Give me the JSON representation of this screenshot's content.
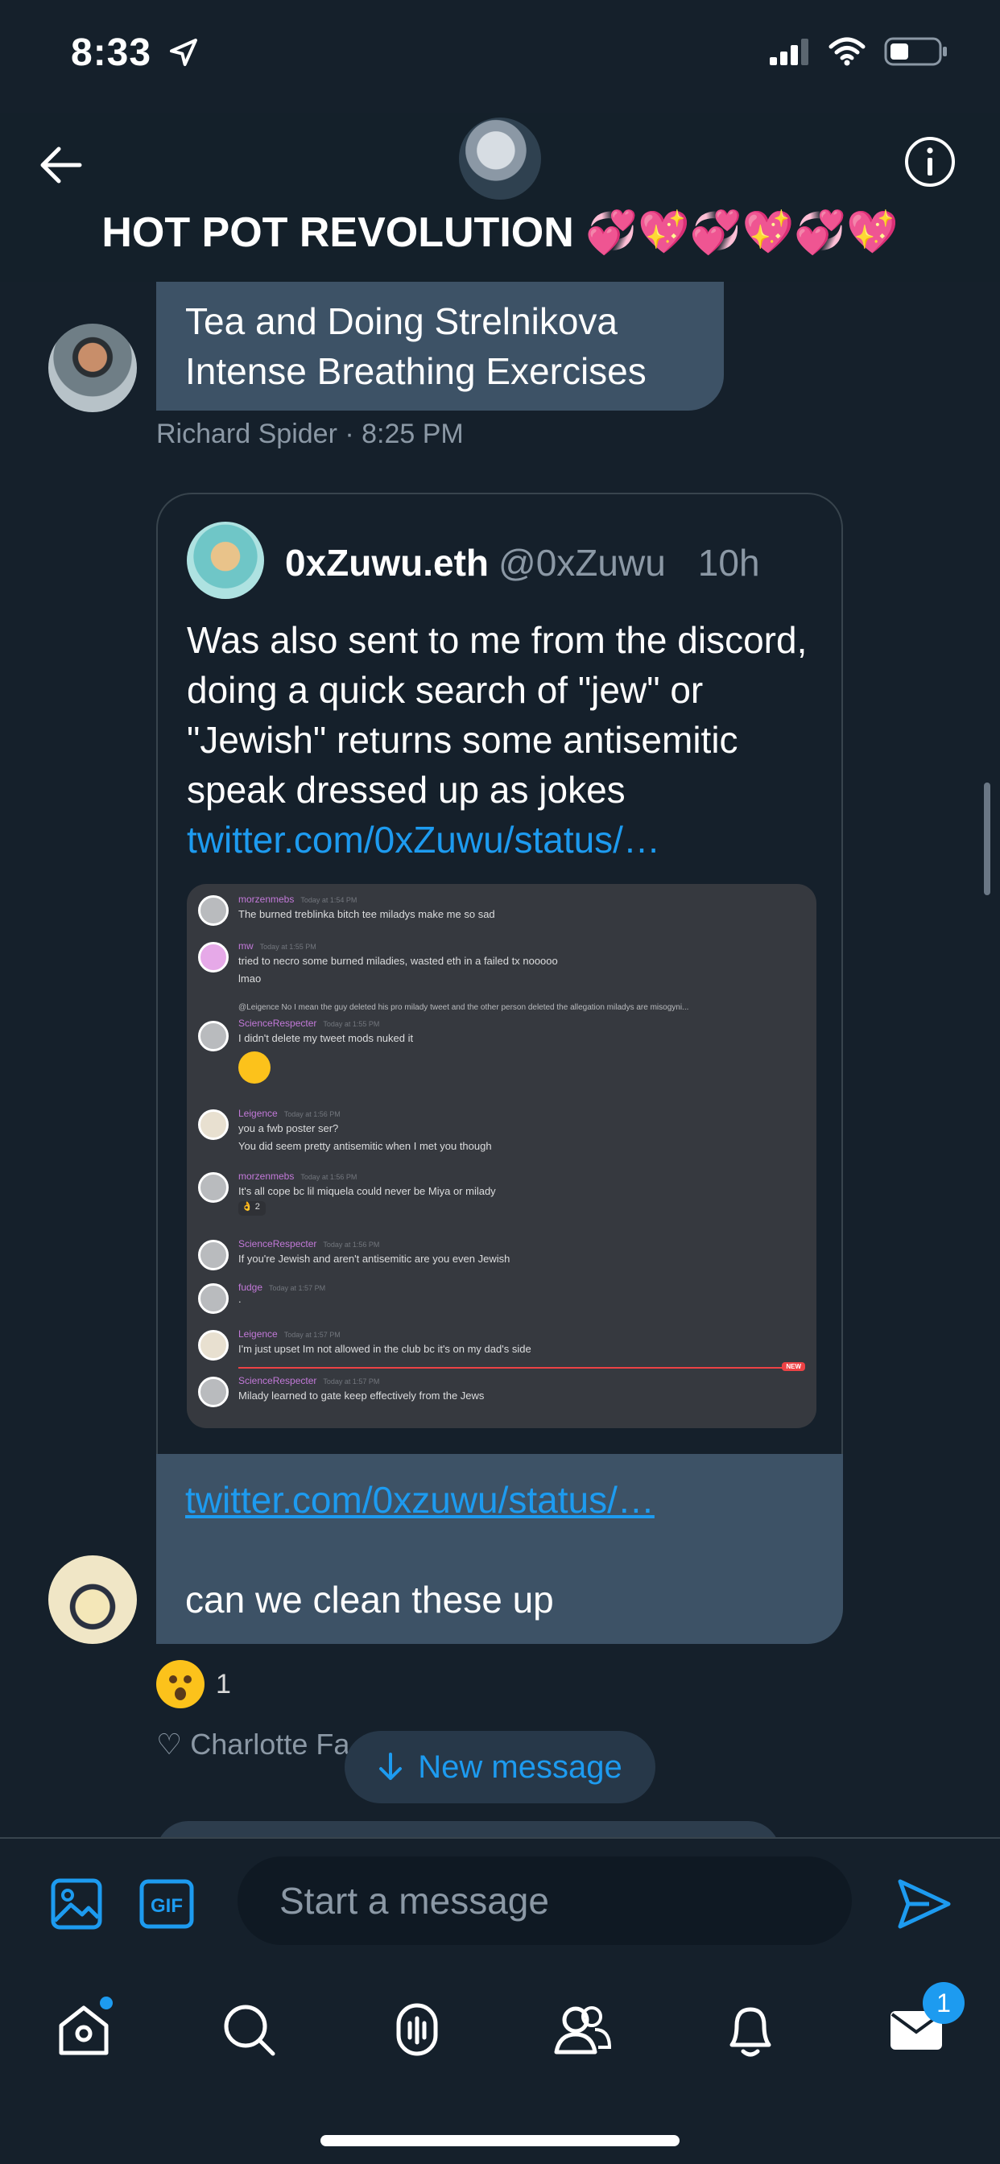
{
  "status_bar": {
    "time": "8:33"
  },
  "header": {
    "title": "HOT POT REVOLUTION 💞💖💞💖💞💖"
  },
  "previous_message": {
    "text_line1": "Tea and Doing Strelnikova",
    "text_line2": "Intense Breathing Exercises",
    "sender": "Richard Spider",
    "time": "8:25 PM"
  },
  "quoted_tweet": {
    "name": "0xZuwu.eth",
    "handle": "@0xZuwu",
    "age": "10h",
    "text": "Was also sent to me from the discord, doing a quick search of \"jew\" or \"Jewish\" returns some antisemitic speak dressed up as jokes",
    "link": "twitter.com/0xZuwu/status/…"
  },
  "discord_screenshot": {
    "messages": [
      {
        "author": "morzenmebs",
        "stamp": "Today at 1:54 PM",
        "text": "The burned treblinka bitch tee miladys make me so sad"
      },
      {
        "author": "mw",
        "stamp": "Today at 1:55 PM",
        "text": "tried to necro some burned miladies, wasted eth in a failed tx nooooo",
        "text2": "lmao"
      },
      {
        "reply": "@Leigence No I mean the guy deleted his pro milady tweet and the other person deleted the allegation miladys are misogyni...",
        "author": "ScienceRespecter",
        "stamp": "Today at 1:55 PM",
        "text": "I didn't delete my tweet mods nuked it"
      },
      {
        "author": "Leigence",
        "stamp": "Today at 1:56 PM",
        "text": "you a fwb poster ser?",
        "text2": "You did seem pretty antisemitic when I met you though"
      },
      {
        "author": "morzenmebs",
        "stamp": "Today at 1:56 PM",
        "text": "It's all cope bc lil miquela could never be Miya or milady",
        "reaction": "2"
      },
      {
        "author": "ScienceRespecter",
        "stamp": "Today at 1:56 PM",
        "text": "If you're Jewish and aren't antisemitic are you even Jewish"
      },
      {
        "author": "fudge",
        "stamp": "Today at 1:57 PM",
        "text": "."
      },
      {
        "author": "Leigence",
        "stamp": "Today at 1:57 PM",
        "text": "I'm just upset Im not allowed in the club bc it's on my dad's side"
      },
      {
        "author": "ScienceRespecter",
        "stamp": "Today at 1:57 PM",
        "text": "Milady learned to gate keep effectively from the Jews"
      }
    ],
    "new_label": "NEW"
  },
  "main_message": {
    "link": "twitter.com/0xzuwu/status/…",
    "text": "can we clean these up",
    "reaction_count": "1",
    "liked_by": "♡ Charlotte Fa"
  },
  "new_message_pill": {
    "label": "New message"
  },
  "composer": {
    "placeholder": "Start a message"
  },
  "tabbar": {
    "messages_badge": "1"
  },
  "colors": {
    "accent": "#1d9bf0",
    "background": "#15202b",
    "bubble": "#3d5266"
  }
}
